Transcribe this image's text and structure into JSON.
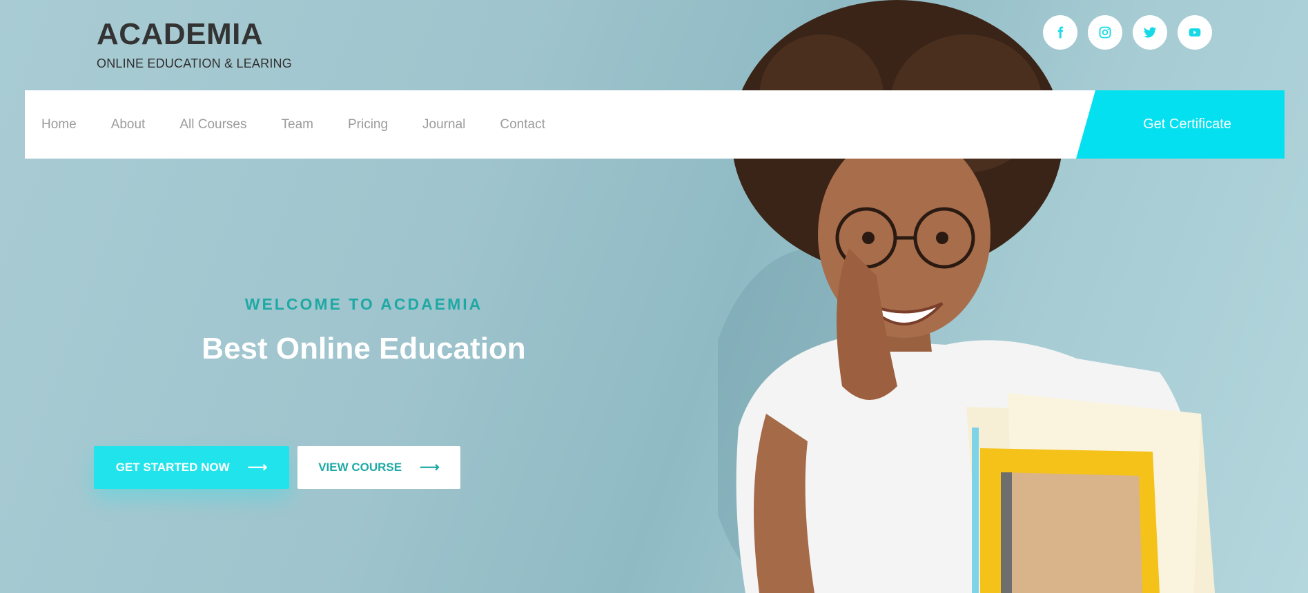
{
  "brand": {
    "title": "ACADEMIA",
    "subtitle": "ONLINE EDUCATION & LEARING"
  },
  "socials": [
    {
      "name": "facebook",
      "icon": "facebook-icon"
    },
    {
      "name": "instagram",
      "icon": "instagram-icon"
    },
    {
      "name": "twitter",
      "icon": "twitter-icon"
    },
    {
      "name": "youtube",
      "icon": "youtube-icon"
    }
  ],
  "nav": {
    "items": [
      "Home",
      "About",
      "All Courses",
      "Team",
      "Pricing",
      "Journal",
      "Contact"
    ],
    "cta_label": "Get Certificate"
  },
  "hero": {
    "kicker": "WELCOME TO ACDAEMIA",
    "title": "Best Online Education",
    "primary_button": "GET STARTED NOW",
    "secondary_button": "VIEW COURSE",
    "arrow_icon": "arrow-right-icon"
  },
  "colors": {
    "accent": "#05e0f0",
    "teal_text": "#1fa9a4",
    "social_icon": "#18d9e6",
    "background": "#a6cbd3"
  }
}
